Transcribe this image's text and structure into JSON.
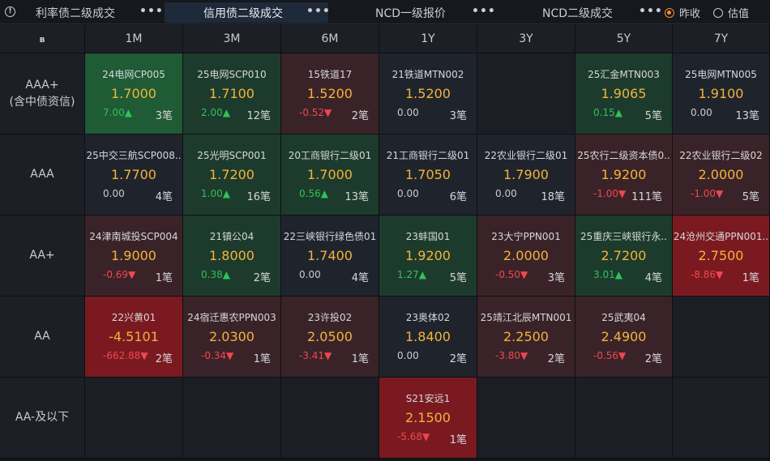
{
  "tabs": [
    {
      "label": "利率债二级成交",
      "active": false
    },
    {
      "label": "信用债二级成交",
      "active": true
    },
    {
      "label": "NCD一级报价",
      "active": false
    },
    {
      "label": "NCD二级成交",
      "active": false
    }
  ],
  "more_glyph": "•••",
  "radio": {
    "options": [
      {
        "label": "昨收",
        "checked": true
      },
      {
        "label": "估值",
        "checked": false
      }
    ]
  },
  "header": {
    "corner_glyph": "ʙ",
    "tenors": [
      "1M",
      "3M",
      "6M",
      "1Y",
      "3Y",
      "5Y",
      "7Y"
    ]
  },
  "colors": {
    "yield": "#f2b33d",
    "up": "#2fc25b",
    "down": "#f0474f",
    "accent": "#ff8a2a"
  },
  "rows": [
    {
      "rating": "AAA+",
      "rating_sub": "(含中债资信)",
      "cells": [
        {
          "name": "24电网CP005",
          "yield": "1.7000",
          "change": "7.00▲",
          "dir": "up",
          "count": "3笔",
          "bg": "green-strong"
        },
        {
          "name": "25电网SCP010",
          "yield": "1.7100",
          "change": "2.00▲",
          "dir": "up",
          "count": "12笔",
          "bg": "green"
        },
        {
          "name": "15铁道17",
          "yield": "1.5200",
          "change": "-0.52▼",
          "dir": "down",
          "count": "2笔",
          "bg": "red"
        },
        {
          "name": "21铁道MTN002",
          "yield": "1.5200",
          "change": "0.00",
          "dir": "flat",
          "count": "3笔",
          "bg": "neutral"
        },
        null,
        {
          "name": "25汇金MTN003",
          "yield": "1.9065",
          "change": "0.15▲",
          "dir": "up",
          "count": "5笔",
          "bg": "green"
        },
        {
          "name": "25电网MTN005",
          "yield": "1.9100",
          "change": "0.00",
          "dir": "flat",
          "count": "13笔",
          "bg": "neutral"
        }
      ]
    },
    {
      "rating": "AAA",
      "rating_sub": "",
      "cells": [
        {
          "name": "25中交三航SCP008..",
          "yield": "1.7700",
          "change": "0.00",
          "dir": "flat",
          "count": "4笔",
          "bg": "neutral"
        },
        {
          "name": "25光明SCP001",
          "yield": "1.7200",
          "change": "1.00▲",
          "dir": "up",
          "count": "16笔",
          "bg": "green"
        },
        {
          "name": "20工商银行二级01",
          "yield": "1.7000",
          "change": "0.56▲",
          "dir": "up",
          "count": "13笔",
          "bg": "green"
        },
        {
          "name": "21工商银行二级01",
          "yield": "1.7050",
          "change": "0.00",
          "dir": "flat",
          "count": "6笔",
          "bg": "neutral"
        },
        {
          "name": "22农业银行二级01",
          "yield": "1.7900",
          "change": "0.00",
          "dir": "flat",
          "count": "18笔",
          "bg": "neutral"
        },
        {
          "name": "25农行二级资本债0..",
          "yield": "1.9200",
          "change": "-1.00▼",
          "dir": "down",
          "count": "111笔",
          "bg": "red"
        },
        {
          "name": "22农业银行二级02",
          "yield": "2.0000",
          "change": "-1.00▼",
          "dir": "down",
          "count": "5笔",
          "bg": "red"
        }
      ]
    },
    {
      "rating": "AA+",
      "rating_sub": "",
      "cells": [
        {
          "name": "24津南城投SCP004",
          "yield": "1.9000",
          "change": "-0.69▼",
          "dir": "down",
          "count": "1笔",
          "bg": "red"
        },
        {
          "name": "21镇公04",
          "yield": "1.8000",
          "change": "0.38▲",
          "dir": "up",
          "count": "2笔",
          "bg": "green"
        },
        {
          "name": "22三峡银行绿色债01",
          "yield": "1.7400",
          "change": "0.00",
          "dir": "flat",
          "count": "4笔",
          "bg": "neutral"
        },
        {
          "name": "23蚌国01",
          "yield": "1.9200",
          "change": "1.27▲",
          "dir": "up",
          "count": "5笔",
          "bg": "green"
        },
        {
          "name": "23大宁PPN001",
          "yield": "2.0000",
          "change": "-0.50▼",
          "dir": "down",
          "count": "3笔",
          "bg": "red"
        },
        {
          "name": "25重庆三峡银行永..",
          "yield": "2.7200",
          "change": "3.01▲",
          "dir": "up",
          "count": "4笔",
          "bg": "green"
        },
        {
          "name": "24沧州交通PPN001..",
          "yield": "2.7500",
          "change": "-8.86▼",
          "dir": "down",
          "count": "1笔",
          "bg": "red-strong"
        }
      ]
    },
    {
      "rating": "AA",
      "rating_sub": "",
      "cells": [
        {
          "name": "22兴黄01",
          "yield": "-4.5101",
          "change": "-662.88▼",
          "dir": "down",
          "count": "2笔",
          "bg": "red-strong"
        },
        {
          "name": "24宿迁惠农PPN003",
          "yield": "2.0300",
          "change": "-0.34▼",
          "dir": "down",
          "count": "1笔",
          "bg": "red"
        },
        {
          "name": "23许投02",
          "yield": "2.0500",
          "change": "-3.41▼",
          "dir": "down",
          "count": "1笔",
          "bg": "red"
        },
        {
          "name": "23奥体02",
          "yield": "1.8400",
          "change": "0.00",
          "dir": "flat",
          "count": "2笔",
          "bg": "neutral"
        },
        {
          "name": "25靖江北辰MTN001",
          "yield": "2.2500",
          "change": "-3.80▼",
          "dir": "down",
          "count": "2笔",
          "bg": "red"
        },
        {
          "name": "25武夷04",
          "yield": "2.4900",
          "change": "-0.56▼",
          "dir": "down",
          "count": "2笔",
          "bg": "red"
        },
        null
      ]
    },
    {
      "rating": "AA-及以下",
      "rating_sub": "",
      "cells": [
        null,
        null,
        null,
        {
          "name": "S21安远1",
          "yield": "2.1500",
          "change": "-5.68▼",
          "dir": "down",
          "count": "1笔",
          "bg": "red-strong"
        },
        null,
        null,
        null
      ]
    }
  ]
}
